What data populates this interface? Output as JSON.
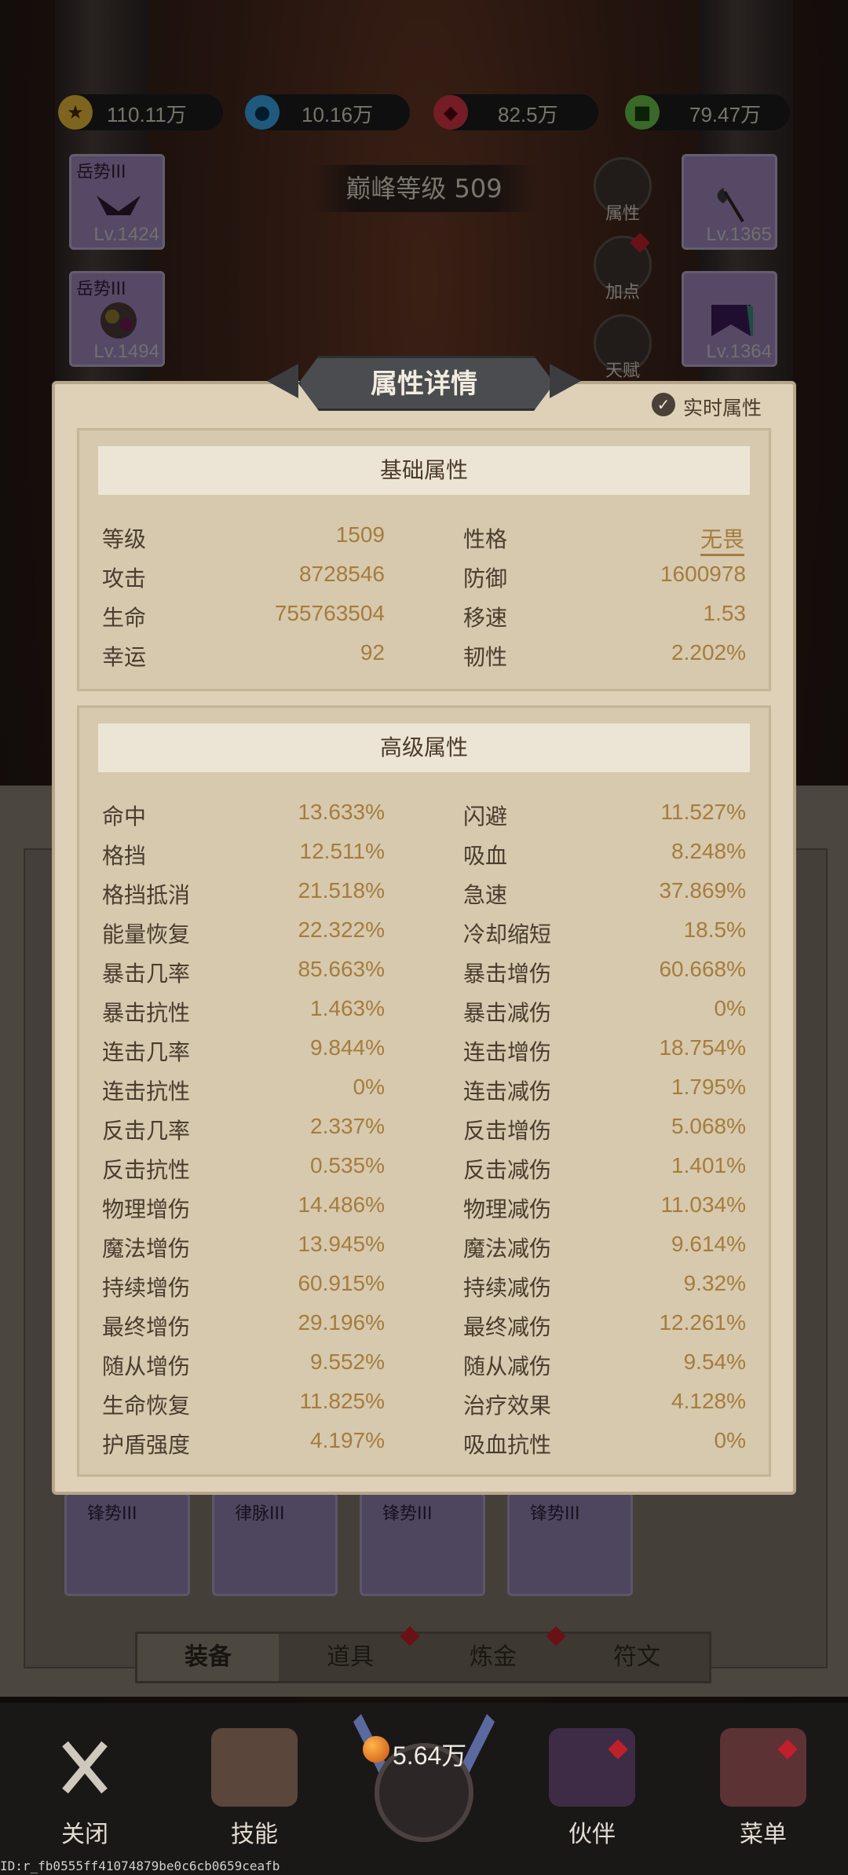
{
  "currencies": [
    {
      "icon": "gold-coin-icon",
      "value": "110.11万",
      "color": "#e5b93a"
    },
    {
      "icon": "blue-orb-icon",
      "value": "10.16万",
      "color": "#3aa3e5"
    },
    {
      "icon": "red-gem-icon",
      "value": "82.5万",
      "color": "#d43645"
    },
    {
      "icon": "green-cash-icon",
      "value": "79.47万",
      "color": "#69c04a"
    }
  ],
  "peak_level": "巅峰等级 509",
  "slots": {
    "top_left": {
      "tag": "岳势III",
      "level": "Lv.1424"
    },
    "second_left": {
      "tag": "岳势III",
      "level": "Lv.1494"
    },
    "top_right": {
      "level": "Lv.1365"
    },
    "second_right": {
      "level": "Lv.1364"
    }
  },
  "side_buttons": [
    "属性",
    "加点",
    "天赋"
  ],
  "dialog": {
    "title": "属性详情",
    "realtime_label": "实时属性",
    "basic": {
      "header": "基础属性",
      "rows": [
        {
          "k1": "等级",
          "v1": "1509",
          "k2": "性格",
          "v2": "无畏"
        },
        {
          "k1": "攻击",
          "v1": "8728546",
          "k2": "防御",
          "v2": "1600978"
        },
        {
          "k1": "生命",
          "v1": "755763504",
          "k2": "移速",
          "v2": "1.53"
        },
        {
          "k1": "幸运",
          "v1": "92",
          "k2": "韧性",
          "v2": "2.202%"
        }
      ]
    },
    "advanced": {
      "header": "高级属性",
      "rows": [
        {
          "k1": "命中",
          "v1": "13.633%",
          "k2": "闪避",
          "v2": "11.527%"
        },
        {
          "k1": "格挡",
          "v1": "12.511%",
          "k2": "吸血",
          "v2": "8.248%"
        },
        {
          "k1": "格挡抵消",
          "v1": "21.518%",
          "k2": "急速",
          "v2": "37.869%"
        },
        {
          "k1": "能量恢复",
          "v1": "22.322%",
          "k2": "冷却缩短",
          "v2": "18.5%"
        },
        {
          "k1": "暴击几率",
          "v1": "85.663%",
          "k2": "暴击增伤",
          "v2": "60.668%"
        },
        {
          "k1": "暴击抗性",
          "v1": "1.463%",
          "k2": "暴击减伤",
          "v2": "0%"
        },
        {
          "k1": "连击几率",
          "v1": "9.844%",
          "k2": "连击增伤",
          "v2": "18.754%"
        },
        {
          "k1": "连击抗性",
          "v1": "0%",
          "k2": "连击减伤",
          "v2": "1.795%"
        },
        {
          "k1": "反击几率",
          "v1": "2.337%",
          "k2": "反击增伤",
          "v2": "5.068%"
        },
        {
          "k1": "反击抗性",
          "v1": "0.535%",
          "k2": "反击减伤",
          "v2": "1.401%"
        },
        {
          "k1": "物理增伤",
          "v1": "14.486%",
          "k2": "物理减伤",
          "v2": "11.034%"
        },
        {
          "k1": "魔法增伤",
          "v1": "13.945%",
          "k2": "魔法减伤",
          "v2": "9.614%"
        },
        {
          "k1": "持续增伤",
          "v1": "60.915%",
          "k2": "持续减伤",
          "v2": "9.32%"
        },
        {
          "k1": "最终增伤",
          "v1": "29.196%",
          "k2": "最终减伤",
          "v2": "12.261%"
        },
        {
          "k1": "随从增伤",
          "v1": "9.552%",
          "k2": "随从减伤",
          "v2": "9.54%"
        },
        {
          "k1": "生命恢复",
          "v1": "11.825%",
          "k2": "治疗效果",
          "v2": "4.128%"
        },
        {
          "k1": "护盾强度",
          "v1": "4.197%",
          "k2": "吸血抗性",
          "v2": "0%"
        }
      ]
    }
  },
  "lower_slots": [
    "锋势III",
    "律脉III",
    "锋势III",
    "锋势III"
  ],
  "tabs": [
    "装备",
    "道具",
    "炼金",
    "符文"
  ],
  "dock": {
    "close": "关闭",
    "skill": "技能",
    "power": "5.64万",
    "partner": "伙伴",
    "menu": "菜单"
  },
  "device_id": "ID:r_fb0555ff41074879be0c6cb0659ceafb"
}
